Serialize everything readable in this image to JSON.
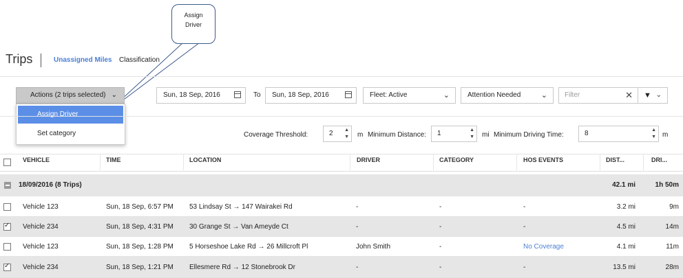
{
  "callout": {
    "line1": "Assign",
    "line2": "Driver"
  },
  "header": {
    "title": "Trips",
    "tabs": [
      "Unassigned Miles",
      "Classification"
    ]
  },
  "toolbar": {
    "actions_label": "Actions (2 trips selected)",
    "menu": [
      "Assign Driver",
      "Set category"
    ],
    "date_from": "Sun, 18 Sep, 2016",
    "to_label": "To",
    "date_to": "Sun, 18 Sep, 2016",
    "fleet": "Fleet: Active",
    "attention": "Attention Needed",
    "filter_placeholder": "Filter"
  },
  "thresholds": {
    "coverage_label": "Coverage Threshold:",
    "coverage_value": "2",
    "coverage_unit": "m",
    "distance_label": "Minimum Distance:",
    "distance_value": "1",
    "distance_unit": "mi",
    "driving_label": "Minimum Driving Time:",
    "driving_value": "8",
    "driving_unit": "m"
  },
  "table": {
    "columns": [
      "VEHICLE",
      "TIME",
      "LOCATION",
      "DRIVER",
      "CATEGORY",
      "HOS EVENTS",
      "DIST...",
      "DRI..."
    ],
    "group": {
      "label": "18/09/2016 (8 Trips)",
      "distance": "42.1 mi",
      "duration": "1h 50m"
    },
    "rows": [
      {
        "vehicle": "Vehicle 123",
        "time": "Sun, 18 Sep, 6:57 PM",
        "location": "53 Lindsay St → 147 Wairakei Rd",
        "driver": "-",
        "category": "-",
        "hos": "-",
        "distance": "3.2 mi",
        "duration": "9m",
        "checked": false
      },
      {
        "vehicle": "Vehicle 234",
        "time": "Sun, 18 Sep, 4:31 PM",
        "location": "30 Grange St → Van Ameyde Ct",
        "driver": "-",
        "category": "-",
        "hos": "-",
        "distance": "4.5 mi",
        "duration": "14m",
        "checked": true
      },
      {
        "vehicle": "Vehicle 123",
        "time": "Sun, 18 Sep, 1:28 PM",
        "location": "5 Horseshoe Lake Rd → 26 Millcroft Pl",
        "driver": "John Smith",
        "category": "-",
        "hos": "No Coverage",
        "distance": "4.1 mi",
        "duration": "11m",
        "checked": false
      },
      {
        "vehicle": "Vehicle 234",
        "time": "Sun, 18 Sep, 1:21 PM",
        "location": "Ellesmere Rd → 12 Stonebrook Dr",
        "driver": "-",
        "category": "-",
        "hos": "-",
        "distance": "13.5 mi",
        "duration": "28m",
        "checked": true
      }
    ]
  },
  "colors": {
    "accent": "#4a7fd4",
    "menu_active": "#5b8ee6",
    "selected_row": "#e6e6e6"
  }
}
